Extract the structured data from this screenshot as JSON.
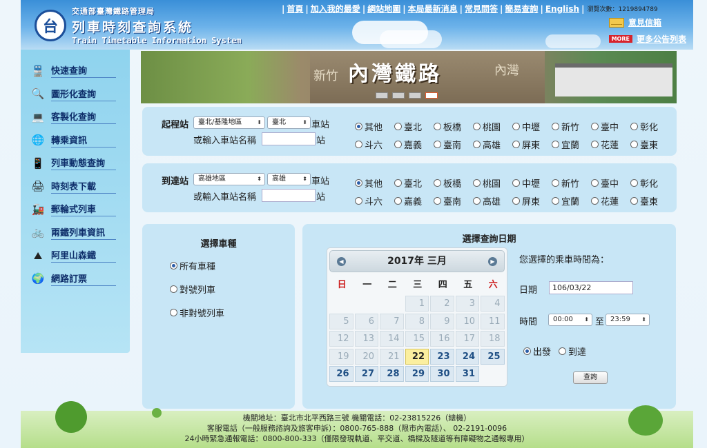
{
  "header": {
    "agency_name": "交通部臺灣鐵路管理局",
    "system_name": "列車時刻查詢系統",
    "system_name_en": "Train Timetable Information System",
    "logo_glyph": "台",
    "nav": [
      "首頁",
      "加入我的最愛",
      "網站地圖",
      "本局最新消息",
      "常見問答",
      "簡易查詢",
      "English"
    ],
    "visit_count": "瀏覽次數：1219894789",
    "mailbox": "意見信箱",
    "more_badge": "MORE",
    "more_news": "更多公告列表"
  },
  "sidebar": {
    "items": [
      {
        "label": "快速查詢",
        "icon": "train-icon"
      },
      {
        "label": "圖形化查詢",
        "icon": "magnifier-icon"
      },
      {
        "label": "客製化查詢",
        "icon": "laptop-icon"
      },
      {
        "label": "轉乘資訊",
        "icon": "globe-icon"
      },
      {
        "label": "列車動態查詢",
        "icon": "pda-icon"
      },
      {
        "label": "時刻表下載",
        "icon": "printer-icon"
      },
      {
        "label": "郵輪式列車",
        "icon": "cruise-train-icon"
      },
      {
        "label": "兩鐵列車資訊",
        "icon": "bike-train-icon"
      },
      {
        "label": "阿里山森鐵",
        "icon": "mountain-icon"
      },
      {
        "label": "網路訂票",
        "icon": "online-ticket-icon"
      }
    ]
  },
  "banner": {
    "title": "內灣鐵路",
    "sub_left": "新竹",
    "sub_right": "內灣",
    "slides": 4,
    "active_slide": 4
  },
  "origin": {
    "label": "起程站",
    "region": "臺北/基隆地區",
    "station": "臺北",
    "station_suffix": "車站",
    "name_prompt": "或輸入車站名稱",
    "name_value": "",
    "name_suffix": "站",
    "options_row1": [
      "其他",
      "臺北",
      "板橋",
      "桃園",
      "中壢",
      "新竹",
      "臺中",
      "彰化"
    ],
    "options_row2": [
      "斗六",
      "嘉義",
      "臺南",
      "高雄",
      "屏東",
      "宜蘭",
      "花蓮",
      "臺東"
    ],
    "selected": "其他"
  },
  "destination": {
    "label": "到達站",
    "region": "高雄地區",
    "station": "高雄",
    "station_suffix": "車站",
    "name_prompt": "或輸入車站名稱",
    "name_value": "",
    "name_suffix": "站",
    "options_row1": [
      "其他",
      "臺北",
      "板橋",
      "桃園",
      "中壢",
      "新竹",
      "臺中",
      "彰化"
    ],
    "options_row2": [
      "斗六",
      "嘉義",
      "臺南",
      "高雄",
      "屏東",
      "宜蘭",
      "花蓮",
      "臺東"
    ],
    "selected": "其他"
  },
  "train_type": {
    "title": "選擇車種",
    "options": [
      "所有車種",
      "對號列車",
      "非對號列車"
    ],
    "selected": "所有車種"
  },
  "date_panel": {
    "title": "選擇查詢日期",
    "calendar_title": "2017年 三月",
    "weekdays": [
      "日",
      "一",
      "二",
      "三",
      "四",
      "五",
      "六"
    ],
    "weeks": [
      [
        "",
        "",
        "",
        "1",
        "2",
        "3",
        "4"
      ],
      [
        "5",
        "6",
        "7",
        "8",
        "9",
        "10",
        "11"
      ],
      [
        "12",
        "13",
        "14",
        "15",
        "16",
        "17",
        "18"
      ],
      [
        "19",
        "20",
        "21",
        "22",
        "23",
        "24",
        "25"
      ],
      [
        "26",
        "27",
        "28",
        "29",
        "30",
        "31",
        ""
      ]
    ],
    "today": "22",
    "chosen_label": "您選擇的乘車時間為：",
    "date_label": "日期",
    "date_value": "106/03/22",
    "time_label": "時間",
    "time_from": "00:00",
    "time_to_label": "至",
    "time_to": "23:59",
    "direction_options": [
      "出發",
      "到達"
    ],
    "direction_selected": "出發",
    "search_label": "查詢"
  },
  "footer": {
    "line1": "機關地址：臺北市北平西路三號  機關電話：02-23815226（總機）",
    "line2": "客服電話（一般服務諮詢及旅客申訴）：0800-765-888（限市內電話）、 02-2191-0096",
    "line3": "24小時緊急通報電話：0800-800-333（僅限發現軌道、平交道、橋樑及隧道等有障礙物之通報專用）"
  },
  "colors": {
    "accent": "#2a5da8",
    "header_blue": "#3a8fd8",
    "panel_bg": "#c8e6f6",
    "today_yellow": "#fbef9f",
    "sunday_red": "#cc1d1d"
  }
}
